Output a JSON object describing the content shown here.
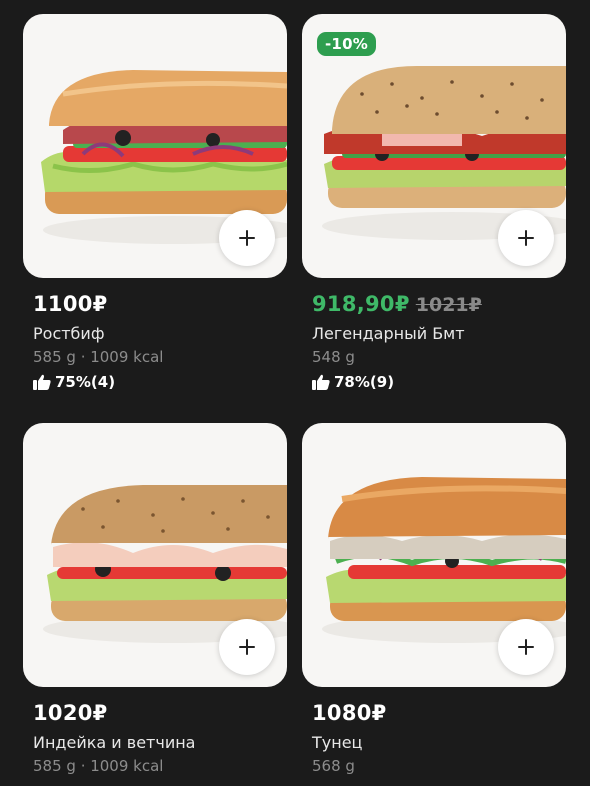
{
  "colors": {
    "background": "#1b1b1b",
    "sale_price": "#3fb968",
    "badge": "#2e9e4f"
  },
  "products": [
    {
      "price": "1100₽",
      "name": "Ростбиф",
      "meta": "585 g · 1009 kcal",
      "rating": "75%(4)",
      "image_icon": "sandwich-roast-beef"
    },
    {
      "badge": "-10%",
      "price": "918,90₽",
      "old_price": "1021₽",
      "name": "Легендарный Бмт",
      "meta": "548 g",
      "rating": "78%(9)",
      "image_icon": "sandwich-bmt"
    },
    {
      "price": "1020₽",
      "name": "Индейка и ветчина",
      "meta": "585 g · 1009 kcal",
      "image_icon": "sandwich-turkey-ham"
    },
    {
      "price": "1080₽",
      "name": "Тунец",
      "meta": "568 g",
      "image_icon": "sandwich-tuna"
    }
  ]
}
